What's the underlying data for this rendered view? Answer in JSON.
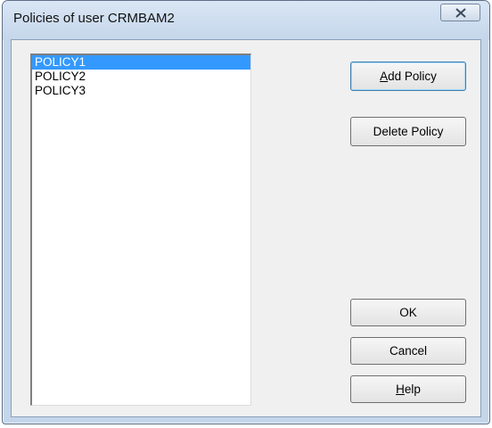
{
  "window": {
    "title": "Policies of user CRMBAM2"
  },
  "policies": {
    "items": [
      "POLICY1",
      "POLICY2",
      "POLICY3"
    ],
    "selected_index": 0
  },
  "buttons": {
    "add_policy": {
      "accel": "A",
      "rest": "dd Policy"
    },
    "delete_policy": "Delete Policy",
    "ok": "OK",
    "cancel": "Cancel",
    "help": {
      "accel": "H",
      "rest": "elp"
    }
  },
  "colors": {
    "selection": "#3399ff",
    "frame": "#c5d6ea"
  }
}
